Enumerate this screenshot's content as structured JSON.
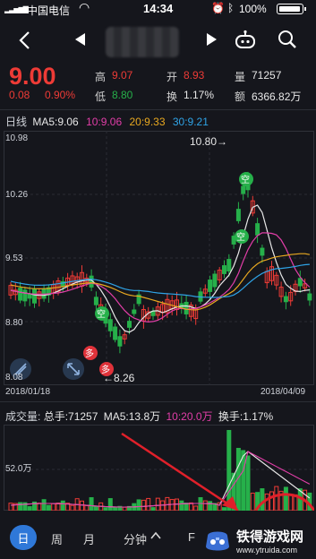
{
  "status_bar": {
    "carrier": "中国电信",
    "time": "14:34",
    "battery": "100%"
  },
  "nav": {
    "back_icon": "chevron-left-icon",
    "prev_icon": "triangle-left-icon",
    "next_icon": "triangle-right-icon",
    "robot_icon": "robot-icon",
    "search_icon": "search-icon"
  },
  "quote": {
    "price": "9.00",
    "change": "0.08",
    "change_pct": "0.90%",
    "high_label": "高",
    "high": "9.07",
    "low_label": "低",
    "low": "8.80",
    "open_label": "开",
    "open": "8.93",
    "turnover_label": "换",
    "turnover": "1.17%",
    "volume_label": "量",
    "volume": "71257",
    "amount_label": "额",
    "amount": "6366.82万"
  },
  "ma_legend": {
    "title": "日线",
    "ma5": "MA5:9.06",
    "ma10": "10:9.06",
    "ma20": "20:9.33",
    "ma30": "30:9.21"
  },
  "kline": {
    "y_labels": [
      "10.98",
      "10.26",
      "9.53",
      "8.80",
      "8.08"
    ],
    "max_annot": "10.80→",
    "min_annot": "←8.26",
    "date_start": "2018/01/18",
    "date_end": "2018/04/09",
    "badge_kong": "空",
    "badge_duo": "多"
  },
  "volume_panel": {
    "title": "成交量:",
    "total": "总手:71257",
    "ma5": "MA5:13.8万",
    "ma10": "10:20.0万",
    "turnover": "换手:1.17%",
    "y_label": "52.0万"
  },
  "bottom_tabs": {
    "day": "日",
    "week": "周",
    "month": "月",
    "minute": "分钟",
    "more": "F"
  },
  "watermark": {
    "brand": "铁得游戏网",
    "url": "www.ytruida.com"
  },
  "colors": {
    "up": "#ee3b36",
    "down": "#26b04a",
    "ma5": "#e8e8e8",
    "ma10": "#e23ea8",
    "ma20": "#e8a820",
    "ma30": "#2fa3e6"
  }
}
